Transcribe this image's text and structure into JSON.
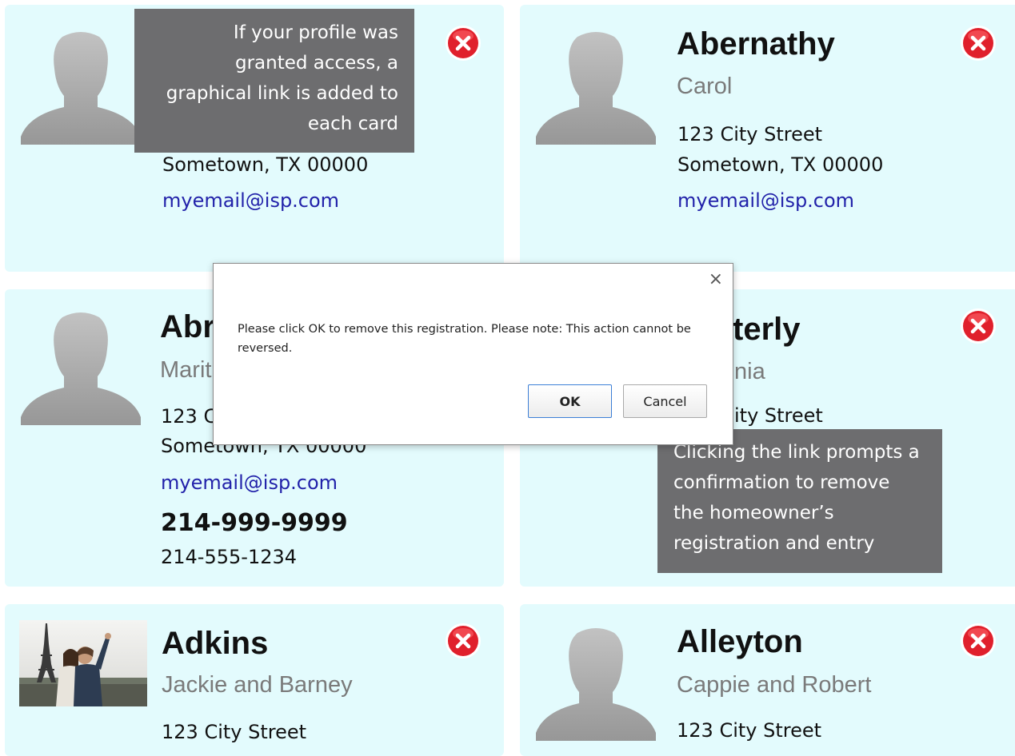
{
  "colors": {
    "card_bg": "#e3fbfd",
    "callout_bg": "#6d6d6f",
    "remove_red": "#e0202c",
    "email_blue": "#2222aa",
    "ok_border": "#3c7fd6"
  },
  "icons": {
    "avatar": "person-silhouette-icon",
    "remove": "remove-x-icon",
    "close": "close-icon"
  },
  "cards": [
    {
      "lastname": "",
      "firstname": "",
      "address_city": "Sometown, TX  00000",
      "email": "myemail@isp.com"
    },
    {
      "lastname": "Abernathy",
      "firstname": "Carol",
      "address_street": "123 City Street",
      "address_city": "Sometown, TX  00000",
      "email": "myemail@isp.com"
    },
    {
      "lastname": "Abr",
      "firstname": "Marit",
      "address_street": "123 C",
      "address_city": "Sometown, TX  00000",
      "email": "myemail@isp.com",
      "phone_main": "214-999-9999",
      "phone_alt": "214-555-1234"
    },
    {
      "lastname": "terly",
      "firstname": "nia",
      "address_street": "ity Street"
    },
    {
      "lastname": "Adkins",
      "firstname": "Jackie and Barney",
      "address_street": "123 City Street"
    },
    {
      "lastname": "Alleyton",
      "firstname": "Cappie and Robert",
      "address_street": "123 City Street"
    }
  ],
  "callouts": {
    "top": [
      "If your profile was",
      "granted access, a",
      "graphical link is added to",
      "each card"
    ],
    "bottom": [
      "Clicking the link prompts a",
      "confirmation to remove",
      "the homeowner’s",
      "registration and entry"
    ]
  },
  "dialog": {
    "close_glyph": "×",
    "message": "Please click OK to remove this registration.  Please note: This action cannot be reversed.",
    "ok_label": "OK",
    "cancel_label": "Cancel"
  }
}
